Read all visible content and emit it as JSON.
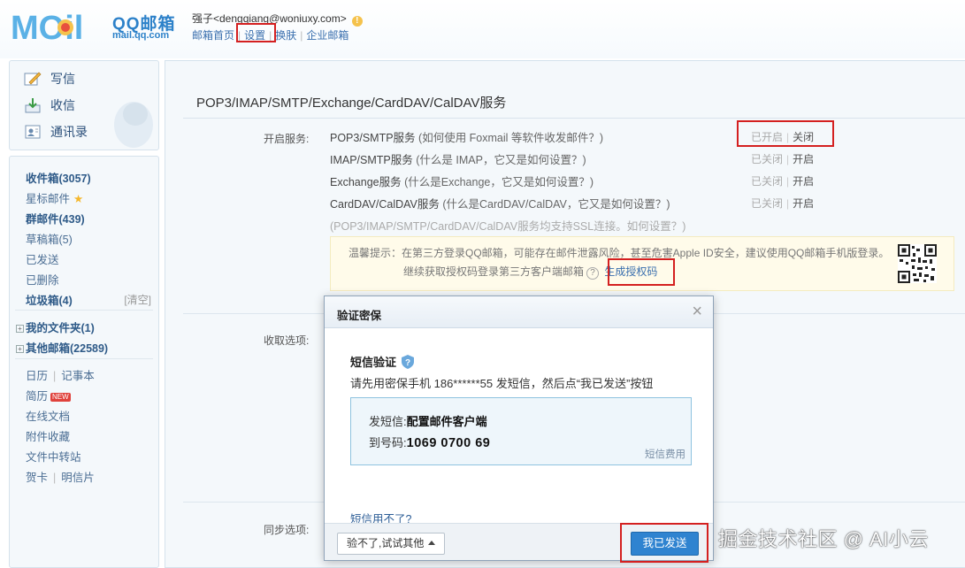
{
  "header": {
    "logo_text": "MOil",
    "brand": "QQ邮箱",
    "brand_url": "mail.qq.com",
    "account": "强子<dengqiang@woniuxy.com>",
    "nav": [
      "邮箱首页",
      "设置",
      "换肤",
      "企业邮箱"
    ]
  },
  "sidebar": {
    "actions": [
      {
        "label": "写信",
        "icon": "compose-icon"
      },
      {
        "label": "收信",
        "icon": "inbox-download-icon"
      },
      {
        "label": "通讯录",
        "icon": "contacts-icon"
      }
    ],
    "folders": {
      "inbox": "收件箱(3057)",
      "starred": "星标邮件",
      "group": "群邮件(439)",
      "drafts": "草稿箱(5)",
      "sent": "已发送",
      "deleted": "已删除",
      "spam": "垃圾箱(4)",
      "spam_clear": "[清空]",
      "my_folders": "我的文件夹(1)",
      "other_mail": "其他邮箱(22589)"
    },
    "tools": {
      "calendar": "日历",
      "notes": "记事本",
      "resume": "简历",
      "resume_badge": "NEW",
      "docs": "在线文档",
      "attachments": "附件收藏",
      "transfer": "文件中转站",
      "card": "贺卡",
      "postcard": "明信片"
    }
  },
  "main": {
    "section_title": "POP3/IMAP/SMTP/Exchange/CardDAV/CalDAV服务",
    "enable_label": "开启服务:",
    "services": [
      {
        "name": "POP3/SMTP服务",
        "hint": "(如何使用 Foxmail 等软件收发邮件？)",
        "status": "已开启",
        "action": "关闭"
      },
      {
        "name": "IMAP/SMTP服务",
        "hint": "(什么是 IMAP，它又是如何设置？)",
        "status": "已关闭",
        "action": "开启"
      },
      {
        "name": "Exchange服务",
        "hint": "(什么是Exchange，它又是如何设置？)",
        "status": "已关闭",
        "action": "开启"
      },
      {
        "name": "CardDAV/CalDAV服务",
        "hint": "(什么是CardDAV/CalDAV，它又是如何设置？)",
        "status": "已关闭",
        "action": "开启"
      }
    ],
    "ssl_note": "(POP3/IMAP/SMTP/CardDAV/CalDAV服务均支持SSL连接。如何设置？)",
    "tip_line1": "温馨提示：在第三方登录QQ邮箱，可能存在邮件泄露风险，甚至危害Apple ID安全，建议使用QQ邮箱手机版登录。",
    "tip_line2": "继续获取授权码登录第三方客户端邮箱",
    "tip_qmark": "?",
    "tip_link": "生成授权码",
    "receive_label": "收取选项:",
    "sync_label": "同步选项:"
  },
  "dialog": {
    "title": "验证密保",
    "close": "×",
    "subtitle": "短信验证",
    "instruction": "请先用密保手机 186******55 发短信，然后点“我已发送”按钮",
    "send_label": "发短信:",
    "send_content": "配置邮件客户端",
    "to_label": "到号码:",
    "to_number": "1069 0700 69",
    "fee": "短信费用",
    "help": "短信用不了?",
    "alt_button": "验不了,试试其他",
    "confirm_button": "我已发送"
  },
  "watermark": "掘金技术社区 @ AI小云",
  "colors": {
    "highlight": "#d42020",
    "primary": "#2f83d0",
    "link": "#3a6fae"
  }
}
